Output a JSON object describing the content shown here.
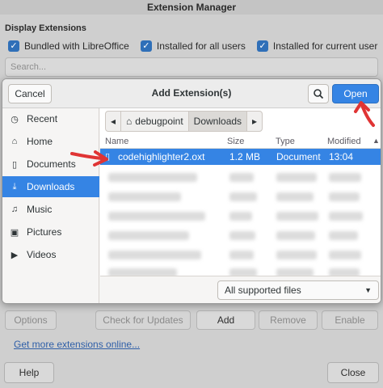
{
  "background_window": {
    "title": "Extension Manager",
    "section_label": "Display Extensions",
    "checkboxes": [
      {
        "label": "Bundled with LibreOffice",
        "checked": true
      },
      {
        "label": "Installed for all users",
        "checked": true
      },
      {
        "label": "Installed for current user",
        "checked": true
      }
    ],
    "search_placeholder": "Search...",
    "buttons": {
      "options": "Options",
      "check_updates": "Check for Updates",
      "add": "Add",
      "remove": "Remove",
      "enable": "Enable"
    },
    "link": "Get more extensions online...",
    "help": "Help",
    "close": "Close"
  },
  "dialog": {
    "title": "Add Extension(s)",
    "cancel": "Cancel",
    "open": "Open",
    "accent": "#3584e4",
    "sidebar": [
      {
        "label": "Recent",
        "icon": "clock-icon",
        "glyph": "◷"
      },
      {
        "label": "Home",
        "icon": "home-icon",
        "glyph": "⌂"
      },
      {
        "label": "Documents",
        "icon": "document-icon",
        "glyph": "▯"
      },
      {
        "label": "Downloads",
        "icon": "download-icon",
        "glyph": "⤓",
        "selected": true
      },
      {
        "label": "Music",
        "icon": "music-icon",
        "glyph": "♫"
      },
      {
        "label": "Pictures",
        "icon": "picture-icon",
        "glyph": "▣"
      },
      {
        "label": "Videos",
        "icon": "video-icon",
        "glyph": "▶"
      }
    ],
    "path": [
      "debugpoint",
      "Downloads"
    ],
    "columns": {
      "name": "Name",
      "size": "Size",
      "type": "Type",
      "modified": "Modified"
    },
    "selected_file": {
      "name": "codehighlighter2.oxt",
      "size": "1.2 MB",
      "type": "Document",
      "modified": "13:04"
    },
    "filter": "All supported files"
  }
}
